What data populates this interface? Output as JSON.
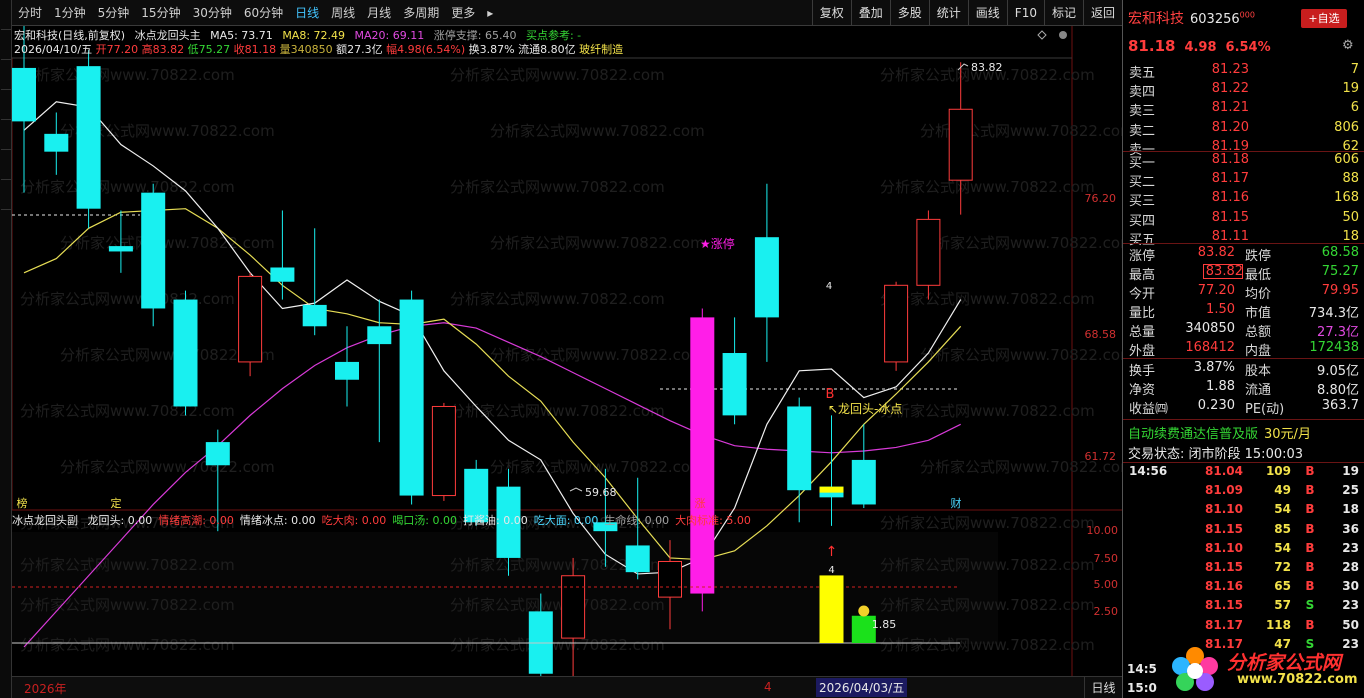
{
  "toolbar": {
    "periods": [
      "分时",
      "1分钟",
      "5分钟",
      "15分钟",
      "30分钟",
      "60分钟",
      "日线",
      "周线",
      "月线",
      "多周期",
      "更多"
    ],
    "active_period": "日线",
    "more_arrow": "▸",
    "right_buttons": [
      "复权",
      "叠加",
      "多股",
      "统计",
      "画线",
      "F10",
      "标记",
      "返回"
    ]
  },
  "header": {
    "stock_title": "宏和科技(日线,前复权)",
    "indicator_name": "冰点龙回头主",
    "ma5": "MA5: 73.71",
    "ma8": "MA8: 72.49",
    "ma20": "MA20: 69.11",
    "support": "涨停支撑: 65.40",
    "ref": "买点参考: -",
    "date": "2026/04/10/五",
    "open": "开77.20",
    "high": "高83.82",
    "low": "低75.27",
    "close": "收81.18",
    "volume": "量340850",
    "amount": "额27.3亿",
    "change": "幅4.98(6.54%)",
    "turnover": "换3.87%",
    "float": "流通8.80亿",
    "industry": "玻纤制造"
  },
  "axis": {
    "labels": [
      "76.20",
      "68.58",
      "61.72"
    ],
    "sub_labels": [
      "10.00",
      "7.50",
      "5.00",
      "2.50"
    ]
  },
  "annotations": {
    "peak": "83.82",
    "low": "59.68",
    "limit_up": "★涨停",
    "buy_b": "B",
    "buy_text": "↖龙回头-冰点",
    "count_4": "4",
    "sub_count_4": "4",
    "sub_value": "1.85",
    "sub_arrow": "↑",
    "bottom_marks": [
      "榜",
      "定",
      "涨",
      "财"
    ]
  },
  "chart_data": {
    "type": "candlestick",
    "price_axis": [
      76.2,
      68.58,
      61.72
    ],
    "candles": [
      {
        "o": 83.5,
        "c": 80.5,
        "h": 86.0,
        "l": 76.5
      },
      {
        "o": 79.8,
        "c": 78.8,
        "h": 81.0,
        "l": 77.5
      },
      {
        "o": 83.6,
        "c": 75.6,
        "h": 84.5,
        "l": 74.5
      },
      {
        "o": 73.5,
        "c": 73.2,
        "h": 75.5,
        "l": 72.0
      },
      {
        "o": 76.5,
        "c": 70.0,
        "h": 77.0,
        "l": 69.0
      },
      {
        "o": 70.5,
        "c": 64.5,
        "h": 71.0,
        "l": 64.0
      },
      {
        "o": 62.5,
        "c": 61.2,
        "h": 63.2,
        "l": 57.5
      },
      {
        "o": 67.0,
        "c": 71.8,
        "h": 72.0,
        "l": 66.2
      },
      {
        "o": 72.3,
        "c": 71.5,
        "h": 75.5,
        "l": 70.5
      },
      {
        "o": 70.2,
        "c": 69.0,
        "h": 74.5,
        "l": 68.5
      },
      {
        "o": 67.0,
        "c": 66.0,
        "h": 69.0,
        "l": 64.5
      },
      {
        "o": 69.0,
        "c": 68.0,
        "h": 70.5,
        "l": 62.5
      },
      {
        "o": 70.5,
        "c": 59.5,
        "h": 71.0,
        "l": 59.0
      },
      {
        "o": 59.5,
        "c": 64.5,
        "h": 64.7,
        "l": 59.2
      },
      {
        "o": 61.0,
        "c": 58.0,
        "h": 61.5,
        "l": 57.8
      },
      {
        "o": 60.0,
        "c": 56.0,
        "h": 61.0,
        "l": 55.0
      },
      {
        "o": 53.0,
        "c": 49.5,
        "h": 54.0,
        "l": 48.5
      },
      {
        "o": 51.5,
        "c": 55.0,
        "h": 56.0,
        "l": 49.0
      },
      {
        "o": 58.0,
        "c": 57.5,
        "h": 61.0,
        "l": 55.5
      },
      {
        "o": 56.7,
        "c": 55.2,
        "h": 60.5,
        "l": 54.8
      },
      {
        "o": 53.8,
        "c": 55.8,
        "h": 57.0,
        "l": 52.0
      },
      {
        "o": 54.0,
        "c": 69.5,
        "h": 70.0,
        "l": 53.0
      },
      {
        "o": 67.5,
        "c": 64.0,
        "h": 69.5,
        "l": 63.5
      },
      {
        "o": 74.0,
        "c": 69.5,
        "h": 77.0,
        "l": 67.0
      },
      {
        "o": 64.5,
        "c": 59.8,
        "h": 65.0,
        "l": 58.0
      },
      {
        "o": 60.0,
        "c": 59.4,
        "h": 64.0,
        "l": 57.8
      },
      {
        "o": 61.5,
        "c": 59.0,
        "h": 63.5,
        "l": 58.8
      },
      {
        "o": 67.0,
        "c": 71.3,
        "h": 71.5,
        "l": 66.5
      },
      {
        "o": 71.3,
        "c": 75.0,
        "h": 75.5,
        "l": 70.5
      },
      {
        "o": 77.2,
        "c": 81.18,
        "h": 83.82,
        "l": 75.27
      }
    ],
    "ma5": [
      80.0,
      81.6,
      81.3,
      79.2,
      78.0,
      76.6,
      74.5,
      72.0,
      70.0,
      70.3,
      71.6,
      70.4,
      69.6,
      66.5,
      64.5,
      62.6,
      61.5,
      58.5,
      56.2,
      55.1,
      55.2,
      56.0,
      58.8,
      63.5,
      66.5,
      66.6,
      65.0,
      65.6,
      67.5,
      70.5
    ],
    "ma8": [
      72.0,
      72.8,
      74.5,
      75.4,
      75.5,
      75.6,
      74.5,
      73.0,
      71.3,
      70.0,
      69.7,
      69.2,
      69.1,
      69.4,
      68.0,
      66.2,
      64.8,
      62.5,
      60.5,
      58.2,
      56.0,
      55.9,
      56.4,
      57.8,
      59.5,
      61.4,
      63.5,
      65.2,
      67.0,
      69.0
    ],
    "ma20": [
      51.0,
      53.0,
      55.0,
      57.0,
      59.0,
      60.8,
      62.3,
      64.0,
      65.5,
      66.8,
      67.8,
      68.5,
      69.0,
      69.2,
      68.9,
      68.1,
      67.3,
      66.4,
      65.5,
      64.6,
      63.7,
      62.9,
      62.3,
      62.1,
      62.0,
      61.9,
      62.0,
      62.2,
      62.6,
      63.5
    ],
    "sub_bars": [
      {
        "index": 25,
        "value": 6.2,
        "color": "#ffff00"
      },
      {
        "index": 26,
        "value": 2.5,
        "color": "#1be11b"
      }
    ]
  },
  "quote": {
    "name": "宏和科技",
    "code": "603256",
    "code_suffix": "000",
    "add_label": "+自选",
    "price": "81.18",
    "change": "4.98",
    "pct": "6.54%",
    "gear": "⚙",
    "asks": [
      {
        "label": "卖五",
        "price": "81.23",
        "vol": "7"
      },
      {
        "label": "卖四",
        "price": "81.22",
        "vol": "19"
      },
      {
        "label": "卖三",
        "price": "81.21",
        "vol": "6"
      },
      {
        "label": "卖二",
        "price": "81.20",
        "vol": "806"
      },
      {
        "label": "卖一",
        "price": "81.19",
        "vol": "62"
      }
    ],
    "bids": [
      {
        "label": "买一",
        "price": "81.18",
        "vol": "606"
      },
      {
        "label": "买二",
        "price": "81.17",
        "vol": "88"
      },
      {
        "label": "买三",
        "price": "81.16",
        "vol": "168"
      },
      {
        "label": "买四",
        "price": "81.15",
        "vol": "50"
      },
      {
        "label": "买五",
        "price": "81.11",
        "vol": "18"
      }
    ],
    "stats": [
      {
        "l1": "涨停",
        "v1": "83.82",
        "c1": "#ff3c3c",
        "l2": "跌停",
        "v2": "68.58",
        "c2": "#34d634"
      },
      {
        "l1": "最高",
        "v1": "83.82",
        "c1": "#ff3c3c",
        "l2": "最低",
        "v2": "75.27",
        "c2": "#34d634"
      },
      {
        "l1": "今开",
        "v1": "77.20",
        "c1": "#ff3c3c",
        "l2": "均价",
        "v2": "79.95",
        "c2": "#ff3c3c"
      },
      {
        "l1": "量比",
        "v1": "1.50",
        "c1": "#ff3c3c",
        "l2": "市值",
        "v2": "734.3亿",
        "c2": "#e8e8e8"
      },
      {
        "l1": "总量",
        "v1": "340850",
        "c1": "#e8e8e8",
        "l2": "总额",
        "v2": "27.3亿",
        "c2": "#e04ae0"
      },
      {
        "l1": "外盘",
        "v1": "168412",
        "c1": "#ff3c3c",
        "l2": "内盘",
        "v2": "172438",
        "c2": "#34d634"
      }
    ],
    "fin": [
      {
        "l1": "换手",
        "v1": "3.87%",
        "l2": "股本",
        "v2": "9.05亿"
      },
      {
        "l1": "净资",
        "v1": "1.88",
        "l2": "流通",
        "v2": "8.80亿"
      },
      {
        "l1": "收益㈣",
        "v1": "0.230",
        "l2": "PE(动)",
        "v2": "363.7"
      }
    ],
    "notice": "自动续费通达信普及版",
    "notice_price": "30元/月",
    "state": "交易状态: 闭市阶段 15:00:03",
    "ticks": [
      {
        "t": "14:56",
        "p": "81.04",
        "v": "109",
        "s": "B",
        "n": "19"
      },
      {
        "t": "",
        "p": "81.09",
        "v": "49",
        "s": "B",
        "n": "25"
      },
      {
        "t": "",
        "p": "81.10",
        "v": "54",
        "s": "B",
        "n": "18"
      },
      {
        "t": "",
        "p": "81.15",
        "v": "85",
        "s": "B",
        "n": "36"
      },
      {
        "t": "",
        "p": "81.10",
        "v": "54",
        "s": "B",
        "n": "23"
      },
      {
        "t": "",
        "p": "81.15",
        "v": "72",
        "s": "B",
        "n": "28"
      },
      {
        "t": "",
        "p": "81.16",
        "v": "65",
        "s": "B",
        "n": "30"
      },
      {
        "t": "",
        "p": "81.15",
        "v": "57",
        "s": "S",
        "n": "23"
      },
      {
        "t": "",
        "p": "81.17",
        "v": "118",
        "s": "B",
        "n": "50"
      },
      {
        "t": "",
        "p": "81.17",
        "v": "47",
        "s": "S",
        "n": "23"
      }
    ],
    "bottom_times": [
      "14:5",
      "15:0"
    ],
    "logo_text": "分析家公式网",
    "logo_url": "www.70822.com"
  },
  "sub_indicator": {
    "name": "冰点龙回头副",
    "items": [
      {
        "text": "龙回头: 0.00",
        "color": "#e8e8e8"
      },
      {
        "text": "情绪高潮: 0.00",
        "color": "#ff3c3c"
      },
      {
        "text": "情绪冰点: 0.00",
        "color": "#e8e8e8"
      },
      {
        "text": "吃大肉: 0.00",
        "color": "#ff3c3c"
      },
      {
        "text": "喝口汤: 0.00",
        "color": "#34d634"
      },
      {
        "text": "打酱油: 0.00",
        "color": "#e8e8e8"
      },
      {
        "text": "吃大面: 0.00",
        "color": "#4ad7ff"
      },
      {
        "text": "生命线: 0.00",
        "color": "#a0a0a0"
      },
      {
        "text": "大肉标准: 5.00",
        "color": "#ff3c3c"
      }
    ]
  },
  "date_bar": {
    "year": "2026年",
    "mark": "4",
    "current": "2026/04/03/五",
    "right_btn": "日线"
  },
  "watermark": "分析家公式网www.70822.com"
}
